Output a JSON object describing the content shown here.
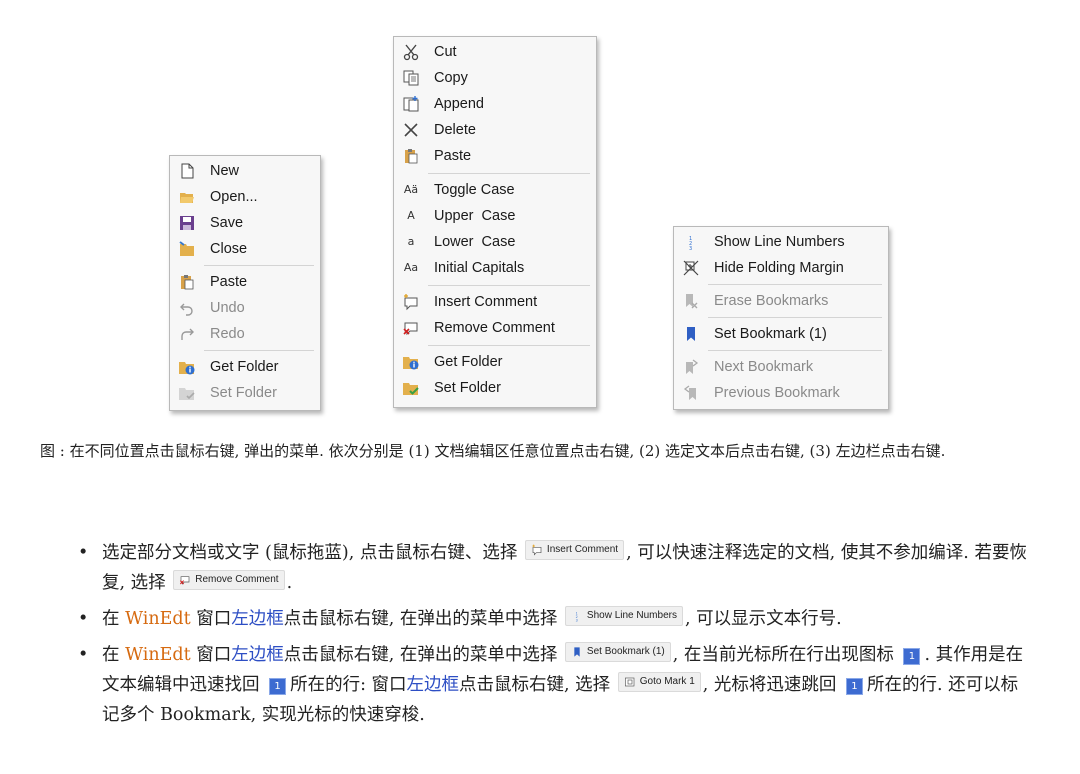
{
  "menu1": {
    "items": [
      {
        "label": "New",
        "icon": "new-file-icon",
        "disabled": false
      },
      {
        "label": "Open...",
        "icon": "open-folder-icon",
        "disabled": false
      },
      {
        "label": "Save",
        "icon": "save-icon",
        "disabled": false
      },
      {
        "label": "Close",
        "icon": "close-folder-icon",
        "disabled": false
      },
      {
        "label": "Paste",
        "icon": "paste-icon",
        "disabled": false
      },
      {
        "label": "Undo",
        "icon": "undo-icon",
        "disabled": true
      },
      {
        "label": "Redo",
        "icon": "redo-icon",
        "disabled": true
      },
      {
        "label": "Get Folder",
        "icon": "get-folder-icon",
        "disabled": false
      },
      {
        "label": "Set Folder",
        "icon": "set-folder-icon",
        "disabled": true
      }
    ]
  },
  "menu2": {
    "items": [
      {
        "label": "Cut",
        "icon": "scissors-icon"
      },
      {
        "label": "Copy",
        "icon": "copy-icon"
      },
      {
        "label": "Append",
        "icon": "append-icon"
      },
      {
        "label": "Delete",
        "icon": "delete-icon"
      },
      {
        "label": "Paste",
        "icon": "paste-icon"
      },
      {
        "label": "Toggle Case",
        "icon": "toggle-case-icon",
        "glyph": "Aä"
      },
      {
        "label": "Upper  Case",
        "icon": "upper-case-icon",
        "glyph": "A"
      },
      {
        "label": "Lower  Case",
        "icon": "lower-case-icon",
        "glyph": "a"
      },
      {
        "label": "Initial Capitals",
        "icon": "initial-capitals-icon",
        "glyph": "Aa"
      },
      {
        "label": "Insert Comment",
        "icon": "insert-comment-icon"
      },
      {
        "label": "Remove Comment",
        "icon": "remove-comment-icon"
      },
      {
        "label": "Get Folder",
        "icon": "get-folder-icon"
      },
      {
        "label": "Set Folder",
        "icon": "set-folder-icon"
      }
    ]
  },
  "menu3": {
    "items": [
      {
        "label": "Show Line Numbers",
        "icon": "line-numbers-icon",
        "disabled": false
      },
      {
        "label": "Hide Folding Margin",
        "icon": "folding-margin-icon",
        "disabled": false
      },
      {
        "label": "Erase Bookmarks",
        "icon": "erase-bookmarks-icon",
        "disabled": true
      },
      {
        "label": "Set Bookmark (1)",
        "icon": "bookmark-icon",
        "disabled": false
      },
      {
        "label": "Next Bookmark",
        "icon": "next-bookmark-icon",
        "disabled": true
      },
      {
        "label": "Previous Bookmark",
        "icon": "previous-bookmark-icon",
        "disabled": true
      }
    ]
  },
  "caption": {
    "label": "图",
    "text": " : 在不同位置点击鼠标右键, 弹出的菜单. 依次分别是 (1) 文档编辑区任意位置点击右键, (2) 选定文本后点击右键, (3) 左边栏点击右键."
  },
  "bullets": {
    "b1_a": "选定部分文档或文字 (鼠标拖蓝), 点击鼠标右键、选择",
    "b1_chip": "Insert Comment",
    "b1_b": ", 可以快速注释选定的文档, 使其不参加编译. 若要恢复, 选择",
    "b1_chip2": "Remove Comment",
    "b1_c": ".",
    "b2_a": "在",
    "b2_winedt": "WinEdt",
    "b2_b": "窗口",
    "b2_link": "左边框",
    "b2_c": "点击鼠标右键, 在弹出的菜单中选择",
    "b2_chip": "Show Line Numbers",
    "b2_d": ", 可以显示文本行号.",
    "b3_a": "在",
    "b3_winedt": "WinEdt",
    "b3_b": "窗口",
    "b3_link": "左边框",
    "b3_c": "点击鼠标右键, 在弹出的菜单中选择",
    "b3_chip": "Set Bookmark (1)",
    "b3_d": ", 在当前光标所在行出现图标",
    "b3_mark": "1",
    "b3_e": ". 其作用是在文本编辑中迅速找回",
    "b3_f": "所在的行: 窗口",
    "b3_link2": "左边框",
    "b3_g": "点击鼠标右键, 选择",
    "b3_chip2": "Goto Mark 1",
    "b3_h": ", 光标将迅速跳回",
    "b3_i": "所在的行. 还可以标记多个 Bookmark, 实现光标的快速穿梭."
  }
}
